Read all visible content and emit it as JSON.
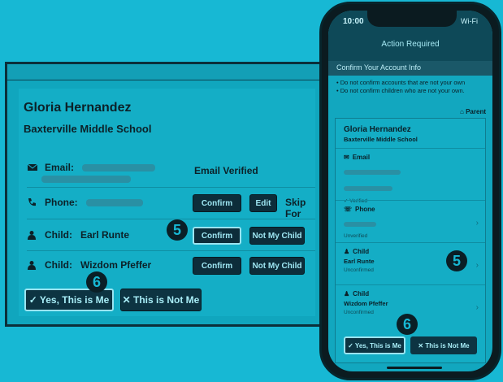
{
  "desktop": {
    "name": "Gloria Hernandez",
    "school": "Baxterville Middle School",
    "rows": [
      {
        "label": "Email:",
        "status": "Email Verified"
      },
      {
        "label": "Phone:",
        "confirm": "Confirm",
        "edit": "Edit",
        "skip": "Skip For"
      },
      {
        "label": "Child:",
        "value": "Earl Runte",
        "confirm": "Confirm",
        "not": "Not My Child"
      },
      {
        "label": "Child:",
        "value": "Wizdom Pfeffer",
        "confirm": "Confirm",
        "not": "Not My Child"
      }
    ],
    "yes": "✓ Yes, This is Me",
    "no": "✕ This is Not Me"
  },
  "steps": {
    "five": "5",
    "six": "6"
  },
  "phone": {
    "time": "10:00",
    "status": "Wi-Fi",
    "header": "Action Required",
    "confirm_bar": "Confirm Your Account Info",
    "warnings": [
      "• Do not confirm accounts that are not your own",
      "• Do not confirm children who are not your own."
    ],
    "parent": "Parent",
    "name": "Gloria Hernandez",
    "school": "Baxterville Middle School",
    "sections": [
      {
        "title": "Email",
        "value": "",
        "status": "✓ Verified"
      },
      {
        "title": "Phone",
        "value": "",
        "status": "Unverified"
      },
      {
        "title": "Child",
        "value": "Earl Runte",
        "status": "Unconfirmed"
      },
      {
        "title": "Child",
        "value": "Wizdom Pfeffer",
        "status": "Unconfirmed"
      }
    ],
    "yes": "✓ Yes, This is Me",
    "no": "✕ This is Not Me"
  },
  "colors": {
    "background": "#17b8d4",
    "button": "#0d2d3a",
    "step": "#0a1f26"
  },
  "icons": [
    "mail-icon",
    "phone-icon",
    "user-icon",
    "home-icon",
    "chevron-right-icon"
  ]
}
